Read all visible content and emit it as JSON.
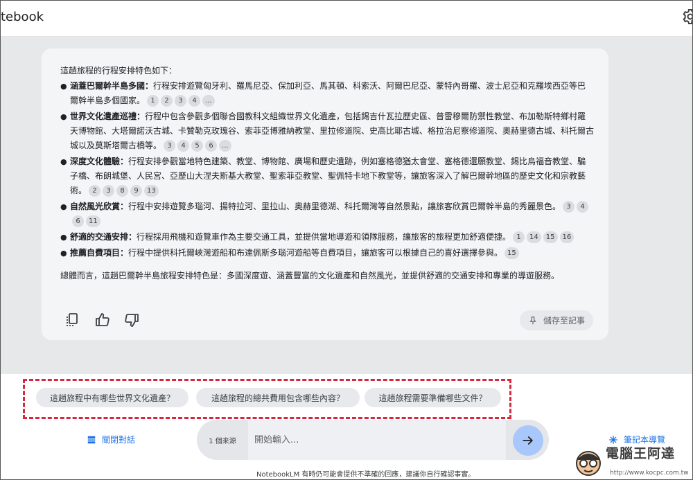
{
  "app": {
    "title": "tebook"
  },
  "response": {
    "intro": "這趟旅程的行程安排特色如下：",
    "bullets": [
      {
        "head": "涵蓋巴爾幹半島多國：",
        "text": "行程安排遊覽匈牙利、羅馬尼亞、保加利亞、馬其頓、科索沃、阿爾巴尼亞、蒙特內哥羅、波士尼亞和克羅埃西亞等巴爾幹半島多個國家。",
        "cites": [
          "1",
          "2",
          "3",
          "4",
          "..."
        ]
      },
      {
        "head": "世界文化遺產巡禮：",
        "text": "行程中包含參觀多個聯合國教科文組織世界文化遺產，包括錫吉什瓦拉歷史區、普雷穆爾防禦性教堂、布加勒斯特鄉村羅天博物館、大塔爾諾沃古城、卡贊勒克玫瑰谷、索菲亞博雅納教堂、里拉修道院、史高比耶古城、格拉治尼察修道院、奧赫里德古城、科托爾古城以及莫斯塔爾古橋等。",
        "cites": [
          "3",
          "4",
          "5",
          "6",
          "..."
        ]
      },
      {
        "head": "深度文化體驗：",
        "text": "行程安排參觀當地特色建築、教堂、博物館、廣場和歷史遺跡，例如塞格德猶太會堂、塞格德還願教堂、錫比烏福音教堂、騙子橋、布朗城堡、人民宮、亞歷山大涅夫斯基大教堂、聖索菲亞教堂、聖佩特卡地下教堂等，讓旅客深入了解巴爾幹地區的歷史文化和宗教藝術。",
        "cites": [
          "2",
          "3",
          "8",
          "9",
          "13"
        ]
      },
      {
        "head": "自然風光欣賞：",
        "text": "行程中安排遊覽多瑙河、揚特拉河、里拉山、奧赫里德湖、科托爾灣等自然景點，讓旅客欣賞巴爾幹半島的秀麗景色。",
        "cites": [
          "3",
          "4",
          "6",
          "11"
        ]
      },
      {
        "head": "舒適的交通安排：",
        "text": "行程採用飛機和遊覽車作為主要交通工具，並提供當地導遊和領隊服務，讓旅客的旅程更加舒適便捷。",
        "cites": [
          "1",
          "14",
          "15",
          "16"
        ]
      },
      {
        "head": "推薦自費項目：",
        "text": "行程中提供科托爾峽灣遊船和布達佩斯多瑙河遊船等自費項目，讓旅客可以根據自己的喜好選擇參與。",
        "cites": [
          "15"
        ]
      }
    ],
    "summary": "總體而言，這趟巴爾幹半島旅程安排特色是：多國深度遊、涵蓋豐富的文化遺產和自然風光，並提供舒適的交通安排和專業的導遊服務。",
    "save_label": "儲存至記事"
  },
  "suggestions": [
    "這趟旅程中有哪些世界文化遺產？",
    "這趟旅程的總共費用包含哪些內容？",
    "這趟旅程需要準備哪些文件？"
  ],
  "footer": {
    "close_chat": "關閉對話",
    "source_count": "1 個來源",
    "input_placeholder": "開始輸入...",
    "guide": "筆記本導覽",
    "disclaimer": "NotebookLM 有時仍可能會提供不準確的回應，建議你自行確認事實。"
  },
  "watermark": {
    "name": "電腦王阿達",
    "url": "http://www.kocpc.com.tw"
  },
  "colors": {
    "accent": "#1a73e8",
    "send": "#a8c7fa",
    "highlight_border": "#d7263d"
  }
}
